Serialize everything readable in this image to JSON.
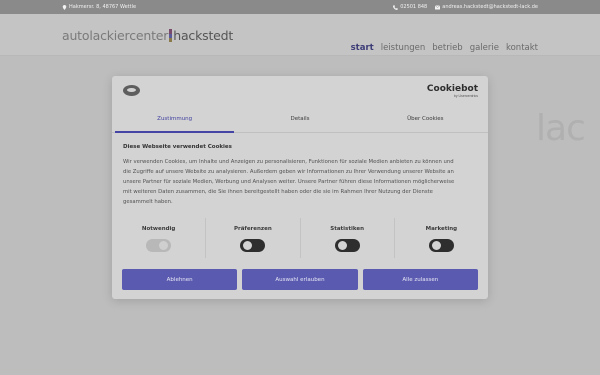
{
  "topbar": {
    "address": "Hakmersr. 8, 48767 Wettle",
    "phone": "02501 848",
    "email": "andreas.hackstedt@hackstedt-lack.de"
  },
  "logo": {
    "prefix": "autolackiercenter",
    "name": "hackstedt"
  },
  "nav": {
    "items": [
      "start",
      "leistungen",
      "betrieb",
      "galerie",
      "kontakt"
    ],
    "active": "start"
  },
  "background_text": "lac",
  "dialog": {
    "brand": "Cookiebot",
    "brand_sub": "by Usercentrics",
    "tabs": [
      "Zustimmung",
      "Details",
      "Über Cookies"
    ],
    "active_tab": "Zustimmung",
    "heading": "Diese Webseite verwendet Cookies",
    "body": "Wir verwenden Cookies, um Inhalte und Anzeigen zu personalisieren, Funktionen für soziale Medien anbieten zu können und die Zugriffe auf unsere Website zu analysieren. Außerdem geben wir Informationen zu Ihrer Verwendung unserer Website an unsere Partner für soziale Medien, Werbung und Analysen weiter. Unsere Partner führen diese Informationen möglicherweise mit weiteren Daten zusammen, die Sie ihnen bereitgestellt haben oder die sie im Rahmen Ihrer Nutzung der Dienste gesammelt haben.",
    "categories": [
      {
        "label": "Notwendig",
        "enabled": true,
        "locked": true
      },
      {
        "label": "Präferenzen",
        "enabled": false,
        "locked": false
      },
      {
        "label": "Statistiken",
        "enabled": false,
        "locked": false
      },
      {
        "label": "Marketing",
        "enabled": false,
        "locked": false
      }
    ],
    "buttons": {
      "reject": "Ablehnen",
      "allow_selection": "Auswahl erlauben",
      "allow_all": "Alle zulassen"
    }
  },
  "colors": {
    "accent": "#4545a5",
    "nav_active": "#3d3d78",
    "overlay": "#bdbdbd"
  }
}
